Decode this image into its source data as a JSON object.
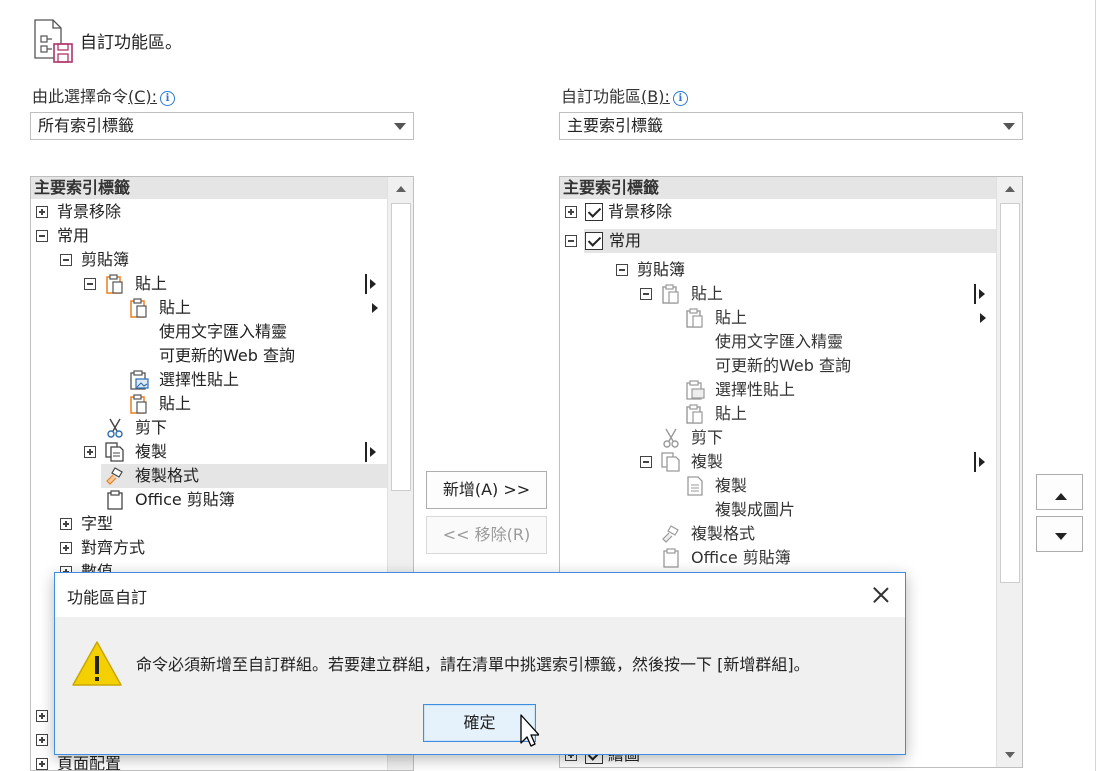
{
  "header": {
    "title": "自訂功能區。"
  },
  "left": {
    "label": "由此選擇命令",
    "label_accel": "(C):",
    "accel_char": "C",
    "dropdown_value": "所有索引標籤",
    "list_header": "主要索引標籤",
    "items": [
      {
        "label": "背景移除"
      },
      {
        "label": "常用"
      },
      {
        "label": "剪貼簿"
      },
      {
        "label": "貼上"
      },
      {
        "label": "貼上"
      },
      {
        "label": "使用文字匯入精靈"
      },
      {
        "label": "可更新的Web 查詢"
      },
      {
        "label": "選擇性貼上"
      },
      {
        "label": "貼上"
      },
      {
        "label": "剪下"
      },
      {
        "label": "複製"
      },
      {
        "label": "複製格式"
      },
      {
        "label": "Office 剪貼簿"
      },
      {
        "label": "字型"
      },
      {
        "label": "對齊方式"
      },
      {
        "label": "數值"
      },
      {
        "label": "頁面配置"
      }
    ]
  },
  "right": {
    "label": "自訂功能區",
    "label_accel": "(B):",
    "dropdown_value": "主要索引標籤",
    "list_header": "主要索引標籤",
    "items": [
      {
        "label": "背景移除",
        "checked": true
      },
      {
        "label": "常用",
        "checked": true
      },
      {
        "label": "剪貼簿"
      },
      {
        "label": "貼上"
      },
      {
        "label": "貼上"
      },
      {
        "label": "使用文字匯入精靈"
      },
      {
        "label": "可更新的Web 查詢"
      },
      {
        "label": "選擇性貼上"
      },
      {
        "label": "貼上"
      },
      {
        "label": "剪下"
      },
      {
        "label": "複製"
      },
      {
        "label": "複製"
      },
      {
        "label": "複製成圖片"
      },
      {
        "label": "複製格式"
      },
      {
        "label": "Office 剪貼簿"
      },
      {
        "label": "繪圖"
      }
    ]
  },
  "middle": {
    "add_button": "新增(A) >>",
    "remove_button": "<< 移除(R)"
  },
  "dialog": {
    "title": "功能區自訂",
    "message": "命令必須新增至自訂群組。若要建立群組，請在清單中挑選索引標籤，然後按一下 [新增群組]。",
    "ok_button": "確定"
  },
  "colors": {
    "accent": "#3d8ee3",
    "selection": "#e5e5e5",
    "warning": "#f5d000",
    "paste_icon": "#e8821e"
  }
}
